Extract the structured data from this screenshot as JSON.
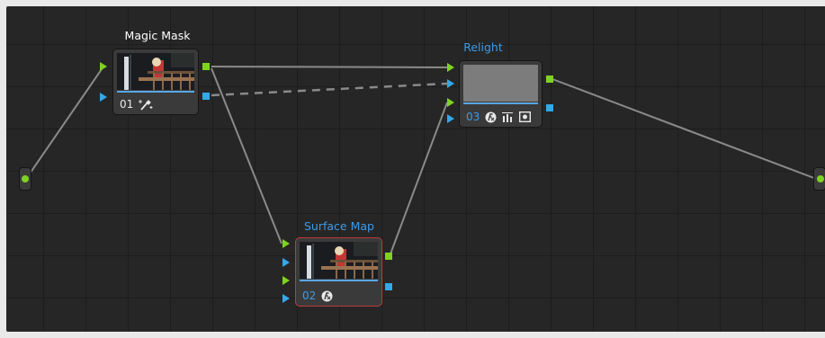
{
  "nodes": {
    "magic_mask": {
      "title": "Magic Mask",
      "number": "01"
    },
    "surface_map": {
      "title": "Surface Map",
      "number": "02"
    },
    "relight": {
      "title": "Relight",
      "number": "03"
    }
  },
  "colors": {
    "title_white": "#ffffff",
    "title_blue": "#3d9bea",
    "rgb_port": "#7ed321",
    "alpha_port": "#35a8e8",
    "selected_outline": "#c0383a"
  },
  "icons": [
    "input-dot-icon",
    "output-dot-icon",
    "magic-wand-icon",
    "fx-icon",
    "graph-icon",
    "window-icon"
  ]
}
